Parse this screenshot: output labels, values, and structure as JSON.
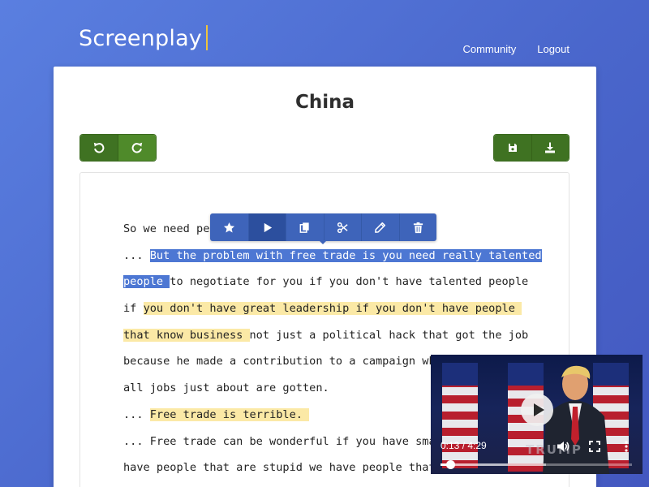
{
  "app": {
    "name": "Screenplay"
  },
  "nav": {
    "community": "Community",
    "logout": "Logout"
  },
  "document": {
    "title": "China"
  },
  "toolbar": {
    "undo_icon": "undo-icon",
    "redo_icon": "redo-icon",
    "save_icon": "save-icon",
    "download_icon": "download-icon"
  },
  "selection_toolbar": [
    {
      "icon": "star-icon"
    },
    {
      "icon": "play-icon"
    },
    {
      "icon": "copy-icon"
    },
    {
      "icon": "scissors-icon"
    },
    {
      "icon": "pencil-icon"
    },
    {
      "icon": "trash-icon"
    }
  ],
  "transcript": {
    "line1": "So we need peo",
    "line2_pre": "... ",
    "line2_sel": "But the problem with free trade is you need really talented",
    "line3_sel": "people ",
    "line3_rest": "to negotiate for you if you don't have talented people",
    "line4_pre": "if ",
    "line4_hl": "you don't have great leadership if you don't have people ",
    "line5_hl": "that know business ",
    "line5_rest": "not just a political hack that got the job",
    "line6": "because he made a contribution to a campaign which",
    "line7": "all jobs just about are gotten.",
    "line8_pre": "... ",
    "line8_hl": "Free trade is terrible. ",
    "line9": "... Free trade can be wonderful if you have smart",
    "line10": "have people that are stupid we have people that a"
  },
  "video": {
    "time": "0:13 / 4:29",
    "overlay_text": "TRUMP",
    "progress": 0.05,
    "buffered": 0.55
  },
  "colors": {
    "accent_green": "#4f8a2a",
    "selection_blue": "#4d77d3",
    "highlight_yellow": "#fbe9a6",
    "toolbar_blue": "#3e64ba"
  }
}
